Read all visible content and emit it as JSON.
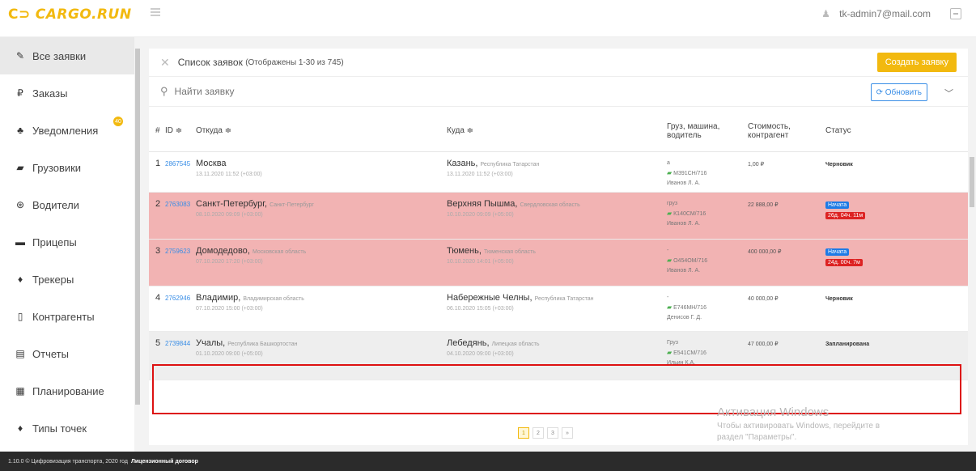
{
  "header": {
    "logo": "CARGO.RUN",
    "logo_mark": "C⊃",
    "user_email": "tk-admin7@mail.com"
  },
  "sidebar": {
    "items": [
      {
        "label": "Все заявки",
        "icon": "edit-icon",
        "glyph": "✎",
        "active": true
      },
      {
        "label": "Заказы",
        "icon": "ruble-icon",
        "glyph": "₽"
      },
      {
        "label": "Уведомления",
        "icon": "bell-icon",
        "glyph": "♣",
        "badge": "40"
      },
      {
        "label": "Грузовики",
        "icon": "truck-icon",
        "glyph": "▰"
      },
      {
        "label": "Водители",
        "icon": "steering-wheel-icon",
        "glyph": "⊛"
      },
      {
        "label": "Прицепы",
        "icon": "trailer-icon",
        "glyph": "▬"
      },
      {
        "label": "Трекеры",
        "icon": "map-pin-icon",
        "glyph": "♦"
      },
      {
        "label": "Контрагенты",
        "icon": "contractors-icon",
        "glyph": "▯"
      },
      {
        "label": "Отчеты",
        "icon": "report-icon",
        "glyph": "▤"
      },
      {
        "label": "Планирование",
        "icon": "calendar-icon",
        "glyph": "▦"
      },
      {
        "label": "Типы точек",
        "icon": "location-icon",
        "glyph": "♦"
      }
    ]
  },
  "page": {
    "title": "Список заявок",
    "subtitle": "(Отображены 1-30 из 745)",
    "create_label": "Создать заявку",
    "search_placeholder": "Найти заявку",
    "refresh_label": "⟳ Обновить"
  },
  "table": {
    "headers": {
      "num": "#",
      "id": "ID ≑",
      "from": "Откуда ≑",
      "to": "Куда ≑",
      "cargo": "Груз, машина, водитель",
      "cost": "Стоимость, контрагент",
      "status": "Статус"
    },
    "rows": [
      {
        "num": "1",
        "id": "2867545",
        "from": "Москва",
        "from_region": "",
        "from_date": "13.11.2020 11:52 (+03:00)",
        "to": "Казань",
        "to_region": "Республика Татарстан",
        "to_date": "13.11.2020 11:52 (+03:00)",
        "cargo": "a",
        "truck": "М391СН/716",
        "driver": "Иванов Л. А.",
        "cost": "1,00 ₽",
        "status": "Черновик",
        "status_type": "draft"
      },
      {
        "num": "2",
        "id": "2763083",
        "from": "Санкт-Петербург",
        "from_region": "Санкт-Петербург",
        "from_date": "08.10.2020 09:09 (+03:00)",
        "to": "Верхняя Пышма",
        "to_region": "Свердловская область",
        "to_date": "10.10.2020 09:09 (+05:00)",
        "cargo": "груз",
        "truck": "К140СМ/716",
        "driver": "Иванов Л. А.",
        "cost": "22 888,00 ₽",
        "status": "Начата",
        "status_extra": "26д. 04ч. 11м",
        "status_type": "started"
      },
      {
        "num": "3",
        "id": "2759623",
        "from": "Домодедово",
        "from_region": "Московская область",
        "from_date": "07.10.2020 17:20 (+03:00)",
        "to": "Тюмень",
        "to_region": "Тюменская область",
        "to_date": "10.10.2020 14:01 (+05:00)",
        "cargo": "-",
        "truck": "О454ОМ/716",
        "driver": "Иванов Л. А.",
        "cost": "400 000,00 ₽",
        "status": "Начата",
        "status_extra": "24д. 00ч. 7м",
        "status_type": "started"
      },
      {
        "num": "4",
        "id": "2762946",
        "from": "Владимир",
        "from_region": "Владимирская область",
        "from_date": "07.10.2020 15:00 (+03:00)",
        "to": "Набережные Челны",
        "to_region": "Республика Татарстан",
        "to_date": "06.10.2020 15:05 (+03:00)",
        "cargo": "-",
        "truck": "Е746МН/716",
        "driver": "Денисов Г. Д.",
        "cost": "40 000,00 ₽",
        "status": "Черновик",
        "status_type": "draft"
      },
      {
        "num": "5",
        "id": "2739844",
        "from": "Учалы",
        "from_region": "Республика Башкортостан",
        "from_date": "01.10.2020 09:00 (+05:00)",
        "to": "Лебедянь",
        "to_region": "Липецкая область",
        "to_date": "04.10.2020 09:00 (+03:00)",
        "cargo": "Груз",
        "truck": "Е541СМ/716",
        "driver": "Ильин К.А.",
        "cost": "47 000,00 ₽",
        "status": "Запланирована",
        "status_type": "planned"
      }
    ]
  },
  "pagination": [
    "1",
    "2",
    "3",
    "»"
  ],
  "watermark": {
    "title": "Активация Windows",
    "line1": "Чтобы активировать Windows, перейдите в",
    "line2": "раздел \"Параметры\"."
  },
  "footer": {
    "text": "1.10.0 © Цифровизация транспорта, 2020 год",
    "link": "Лицензионный договор"
  },
  "colors": {
    "accent": "#f2b90f",
    "highlight_row": "#f2b3b3",
    "link": "#3a8ee6",
    "badge_blue": "#1e7be6",
    "badge_red": "#dd2222",
    "selection_border": "#dd1111"
  }
}
